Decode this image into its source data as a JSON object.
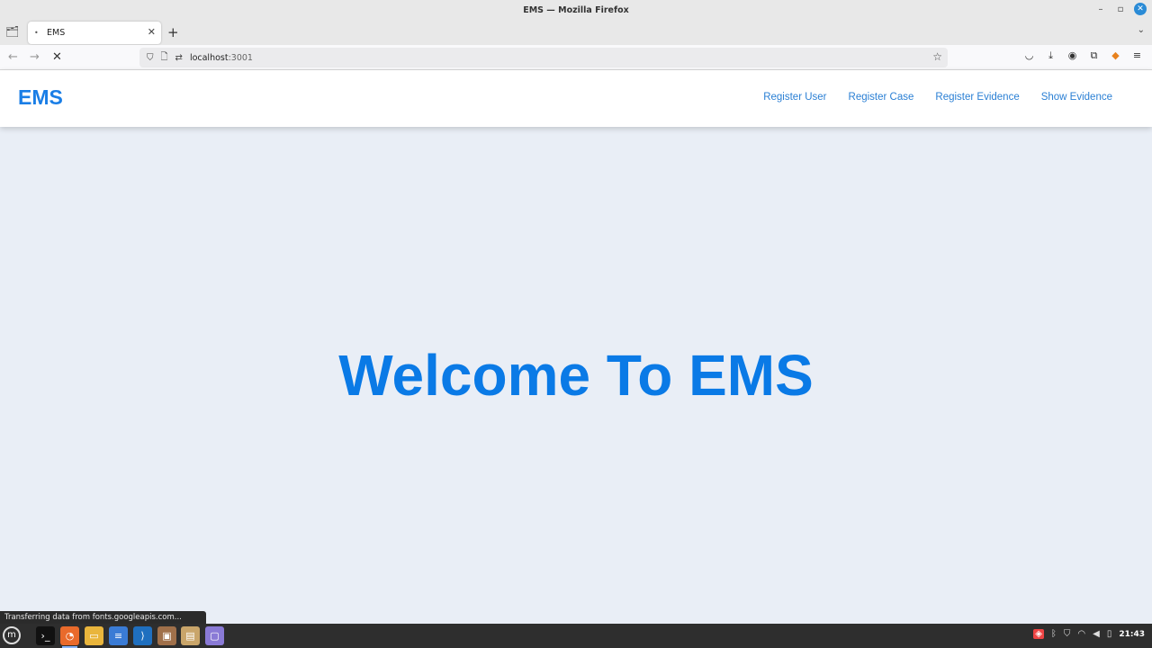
{
  "window": {
    "title": "EMS — Mozilla Firefox"
  },
  "tabs": [
    {
      "label": "EMS"
    }
  ],
  "navbar": {
    "url_host": "localhost",
    "url_port": ":3001"
  },
  "page": {
    "brand": "EMS",
    "nav": [
      {
        "label": "Register User"
      },
      {
        "label": "Register Case"
      },
      {
        "label": "Register Evidence"
      },
      {
        "label": "Show Evidence"
      }
    ],
    "headline": "Welcome To EMS",
    "colors": {
      "brand": "#1a7ee6",
      "headline": "#0a7ae6",
      "background": "#e9eef6"
    }
  },
  "status_bar": {
    "text": "Transferring data from fonts.googleapis.com..."
  },
  "taskbar": {
    "apps": [
      "menu-icon",
      "terminal-icon",
      "firefox-icon",
      "files-icon",
      "text-editor-icon",
      "vscode-icon",
      "package-icon",
      "archive-icon",
      "notes-icon"
    ],
    "clock": "21:43"
  }
}
